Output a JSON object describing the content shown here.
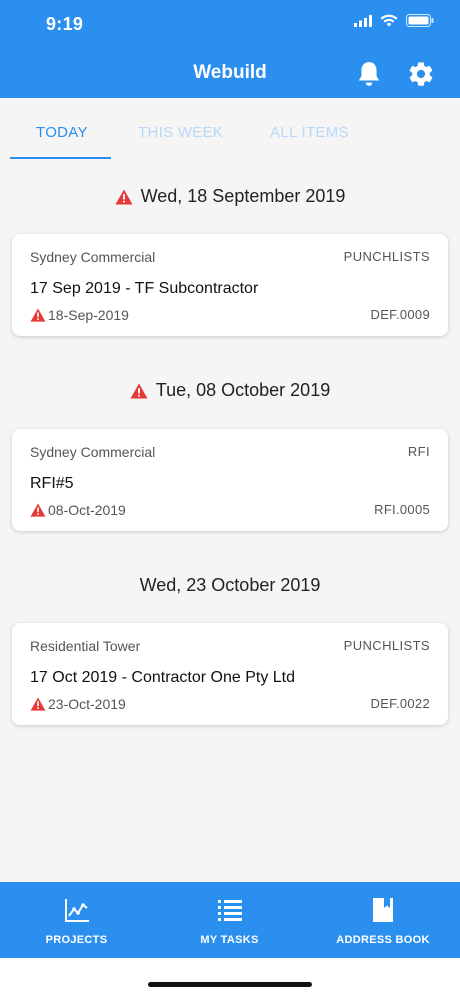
{
  "status": {
    "time": "9:19"
  },
  "header": {
    "title": "Webuild"
  },
  "tabs": [
    {
      "label": "TODAY",
      "active": true
    },
    {
      "label": "THIS WEEK",
      "active": false
    },
    {
      "label": "ALL ITEMS",
      "active": false
    }
  ],
  "groups": [
    {
      "date": "Wed, 18 September 2019",
      "overdue": true,
      "items": [
        {
          "project": "Sydney Commercial",
          "type": "PUNCHLISTS",
          "title": "17 Sep 2019 - TF Subcontractor",
          "due": "18-Sep-2019",
          "ref": "DEF.0009",
          "overdue": true
        }
      ]
    },
    {
      "date": "Tue, 08 October 2019",
      "overdue": true,
      "items": [
        {
          "project": "Sydney Commercial",
          "type": "RFI",
          "title": "RFI#5",
          "due": "08-Oct-2019",
          "ref": "RFI.0005",
          "overdue": true
        }
      ]
    },
    {
      "date": "Wed, 23 October 2019",
      "overdue": false,
      "items": [
        {
          "project": "Residential Tower",
          "type": "PUNCHLISTS",
          "title": "17 Oct 2019 - Contractor One Pty Ltd",
          "due": "23-Oct-2019",
          "ref": "DEF.0022",
          "overdue": true
        }
      ]
    }
  ],
  "bottom_nav": [
    {
      "label": "PROJECTS",
      "icon": "chart-line-icon"
    },
    {
      "label": "MY TASKS",
      "icon": "list-icon"
    },
    {
      "label": "ADDRESS BOOK",
      "icon": "book-icon"
    }
  ],
  "colors": {
    "primary": "#2b8ff0",
    "warning": "#e53935",
    "inactive_tab": "#b7d8f8"
  }
}
